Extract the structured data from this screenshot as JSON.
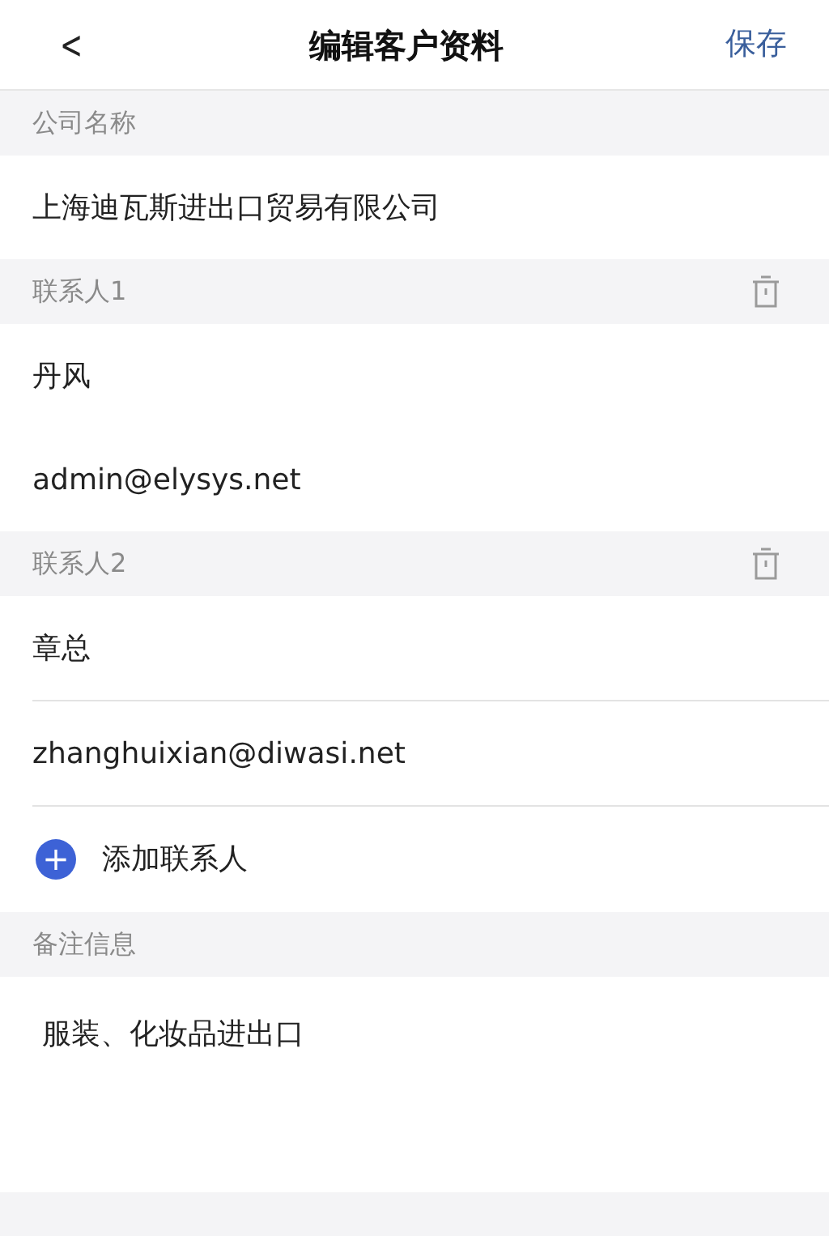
{
  "nav": {
    "back": "<",
    "title": "编辑客户资料",
    "action": "保存"
  },
  "company": {
    "label": "公司名称",
    "value": "上海迪瓦斯进出口贸易有限公司"
  },
  "contacts": [
    {
      "label": "联系人1",
      "name": "丹风",
      "email": "admin@elysys.net"
    },
    {
      "label": "联系人2",
      "name": "章总",
      "email": "zhanghuixian@diwasi.net"
    }
  ],
  "add_contact": {
    "icon": "+",
    "label": "添加联系人"
  },
  "remarks": {
    "label": "备注信息",
    "value": "服装、化妆品进出口"
  }
}
